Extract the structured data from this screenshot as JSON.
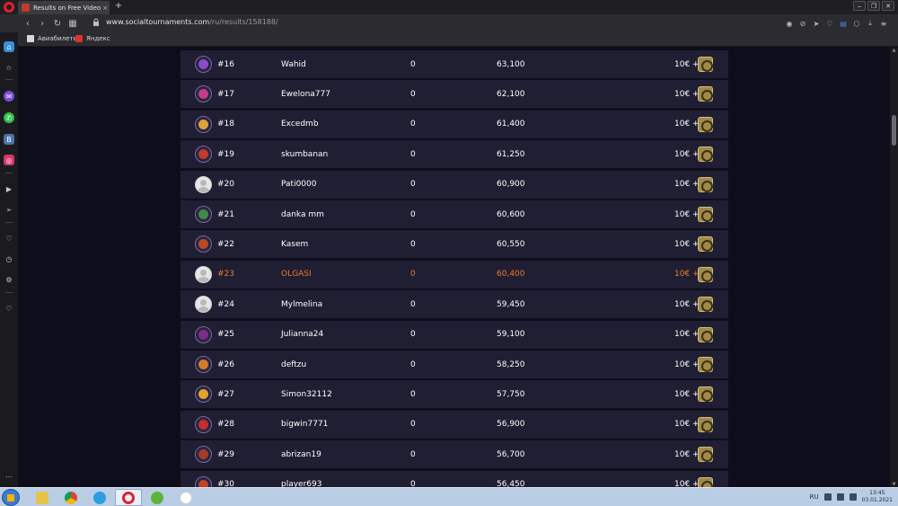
{
  "browser": {
    "tab_title": "Results on Free Video Slot",
    "tab_close": "×",
    "new_tab": "+",
    "url_host": "www.socialtournaments.com",
    "url_path": "/ru/results/158188/",
    "bookmarks": [
      {
        "label": "Авиабилеты"
      },
      {
        "label": "Яндекс"
      }
    ]
  },
  "leaderboard": {
    "rows": [
      {
        "rank": "#16",
        "name": "Wahid",
        "points": "0",
        "score": "63,100",
        "prize": "10€ +",
        "avatar": "#8a4ccf",
        "highlight": false
      },
      {
        "rank": "#17",
        "name": "Ewelona777",
        "points": "0",
        "score": "62,100",
        "prize": "10€ +",
        "avatar": "#c43b8a",
        "highlight": false
      },
      {
        "rank": "#18",
        "name": "Excedmb",
        "points": "0",
        "score": "61,400",
        "prize": "10€ +",
        "avatar": "#d9a23a",
        "highlight": false
      },
      {
        "rank": "#19",
        "name": "skumbanan",
        "points": "0",
        "score": "61,250",
        "prize": "10€ +",
        "avatar": "#c23a2c",
        "highlight": false
      },
      {
        "rank": "#20",
        "name": "Pati0000",
        "points": "0",
        "score": "60,900",
        "prize": "10€ +",
        "avatar": "blank",
        "highlight": false
      },
      {
        "rank": "#21",
        "name": "danka mm",
        "points": "0",
        "score": "60,600",
        "prize": "10€ +",
        "avatar": "#3f8a4a",
        "highlight": false
      },
      {
        "rank": "#22",
        "name": "Kasem",
        "points": "0",
        "score": "60,550",
        "prize": "10€ +",
        "avatar": "#b84a2a",
        "highlight": false
      },
      {
        "rank": "#23",
        "name": "OLGASI",
        "points": "0",
        "score": "60,400",
        "prize": "10€ +",
        "avatar": "blank",
        "highlight": true
      },
      {
        "rank": "#24",
        "name": "Mylmelina",
        "points": "0",
        "score": "59,450",
        "prize": "10€ +",
        "avatar": "blank",
        "highlight": false
      },
      {
        "rank": "#25",
        "name": "Julianna24",
        "points": "0",
        "score": "59,100",
        "prize": "10€ +",
        "avatar": "#7a2e8a",
        "highlight": false
      },
      {
        "rank": "#26",
        "name": "deftzu",
        "points": "0",
        "score": "58,250",
        "prize": "10€ +",
        "avatar": "#d47a2a",
        "highlight": false
      },
      {
        "rank": "#27",
        "name": "Simon32112",
        "points": "0",
        "score": "57,750",
        "prize": "10€ +",
        "avatar": "#e0a22a",
        "highlight": false
      },
      {
        "rank": "#28",
        "name": "bigwin7771",
        "points": "0",
        "score": "56,900",
        "prize": "10€ +",
        "avatar": "#c42e2e",
        "highlight": false
      },
      {
        "rank": "#29",
        "name": "abrizan19",
        "points": "0",
        "score": "56,700",
        "prize": "10€ +",
        "avatar": "#a83a2a",
        "highlight": false
      },
      {
        "rank": "#30",
        "name": "player693",
        "points": "0",
        "score": "56,450",
        "prize": "10€ +",
        "avatar": "#c2402a",
        "highlight": false
      }
    ]
  },
  "taskbar": {
    "lang": "RU",
    "time": "13:45",
    "date": "03.01.2021"
  }
}
